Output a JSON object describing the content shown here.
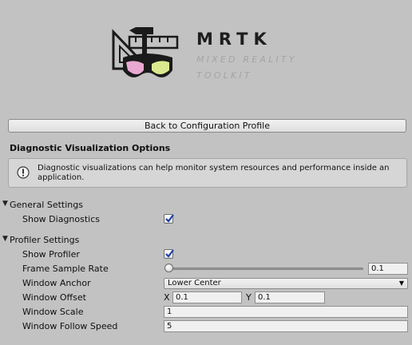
{
  "logo": {
    "title": "MRTK",
    "subtitle_line1": "MIXED REALITY",
    "subtitle_line2": "TOOLKIT"
  },
  "back_button_label": "Back to Configuration Profile",
  "section_title": "Diagnostic Visualization Options",
  "help_text": "Diagnostic visualizations can help monitor system resources and performance inside an application.",
  "general_settings": {
    "label": "General Settings",
    "show_diagnostics_label": "Show Diagnostics",
    "show_diagnostics_checked": true
  },
  "profiler_settings": {
    "label": "Profiler Settings",
    "show_profiler_label": "Show Profiler",
    "show_profiler_checked": true,
    "frame_sample_rate_label": "Frame Sample Rate",
    "frame_sample_rate_value": "0.1",
    "frame_sample_rate_fraction": 0.0,
    "window_anchor_label": "Window Anchor",
    "window_anchor_value": "Lower Center",
    "window_offset_label": "Window Offset",
    "window_offset_x_label": "X",
    "window_offset_x": "0.1",
    "window_offset_y_label": "Y",
    "window_offset_y": "0.1",
    "window_scale_label": "Window Scale",
    "window_scale_value": "1",
    "window_follow_speed_label": "Window Follow Speed",
    "window_follow_speed_value": "5"
  },
  "colors": {
    "background": "#c2c2c2",
    "check": "#1e3fa8"
  },
  "icons": {
    "foldout": "triangle-down",
    "info": "exclamation-circle",
    "dropdown": "triangle-down"
  }
}
